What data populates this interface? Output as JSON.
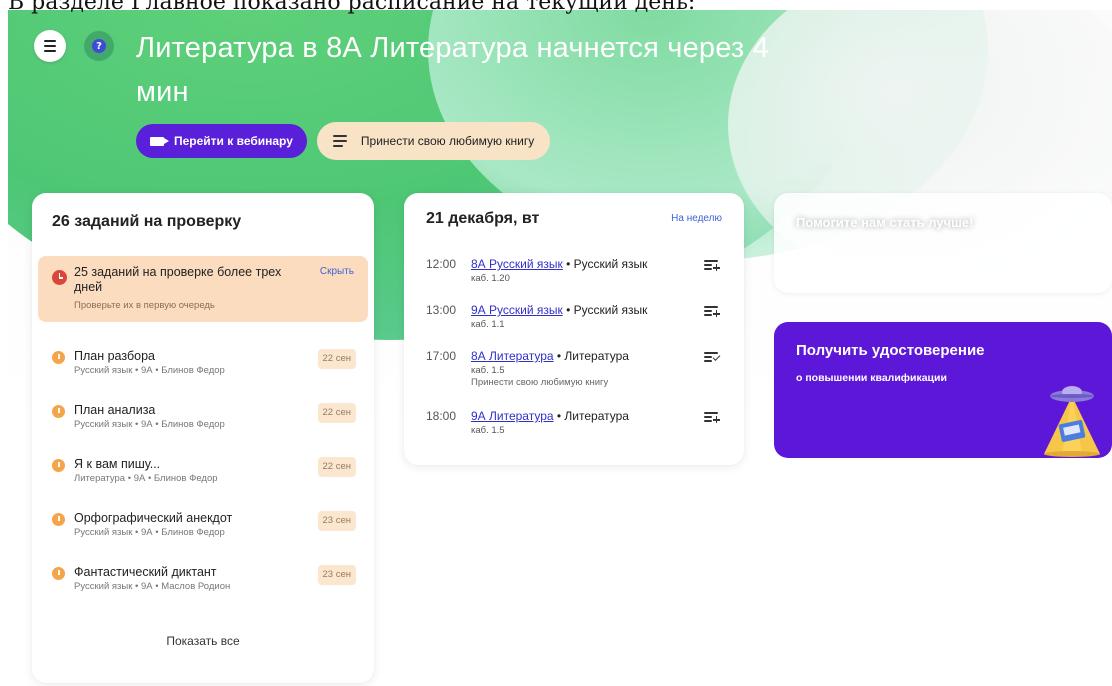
{
  "caption": "В разделе Главное показано расписание на текущий день:",
  "hero": {
    "headline": "Литература в 8А Литература начнется через 4 мин",
    "webinar_button": "Перейти к вебинару",
    "task_button": "Принести свою любимую книгу"
  },
  "tasks_card": {
    "title": "26 заданий на проверку",
    "alert": {
      "title": "25 заданий на проверке более трех дней",
      "subtitle": "Проверьте их в первую очередь",
      "hide": "Скрыть"
    },
    "items": [
      {
        "title": "План разбора",
        "sub": "Русский язык • 9А • Блинов Федор",
        "date": "22 сен"
      },
      {
        "title": "План анализа",
        "sub": "Русский язык • 9А • Блинов Федор",
        "date": "22 сен"
      },
      {
        "title": "Я к вам пишу...",
        "sub": "Литература • 9А • Блинов Федор",
        "date": "22 сен"
      },
      {
        "title": "Орфографический анекдот",
        "sub": "Русский язык • 9А • Блинов Федор",
        "date": "23 сен"
      },
      {
        "title": "Фантастический диктант",
        "sub": "Русский язык • 9А • Маслов Родион",
        "date": "23 сен"
      }
    ],
    "show_all": "Показать все"
  },
  "schedule_card": {
    "title": "21 декабря, вт",
    "week_link": "На неделю",
    "lessons": [
      {
        "time": "12:00",
        "link": "8А Русский язык",
        "subject": " • Русский язык",
        "room": "каб. 1.20",
        "note": "",
        "action": "add"
      },
      {
        "time": "13:00",
        "link": "9А Русский язык",
        "subject": " • Русский язык",
        "room": "каб. 1.1",
        "note": "",
        "action": "add"
      },
      {
        "time": "17:00",
        "link": "8А Литература",
        "subject": " • Литература",
        "room": "каб. 1.5",
        "note": "Принести свою любимую книгу",
        "action": "done"
      },
      {
        "time": "18:00",
        "link": "9А Литература",
        "subject": " • Литература",
        "room": "каб. 1.5",
        "note": "",
        "action": "add"
      }
    ]
  },
  "feedback_card": {
    "text": "Помогите нам стать лучше!"
  },
  "cert_card": {
    "title": "Получить удостоверение",
    "subtitle": "о повышении квалификации"
  },
  "colors": {
    "accent_purple": "#5a1fd8",
    "hero_green": "#4ec775",
    "alert_bg": "#fbdcbf",
    "alert_red": "#d9473b",
    "task_orange": "#f5a44a",
    "link_blue": "#3030c8"
  }
}
